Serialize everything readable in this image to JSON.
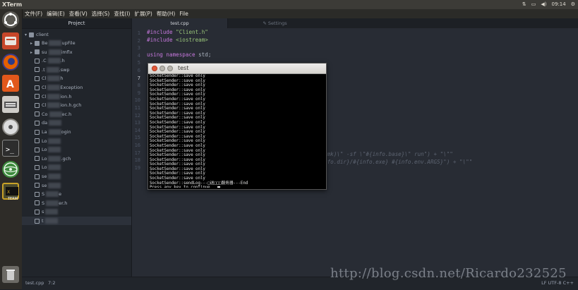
{
  "topbar": {
    "app_title": "XTerm",
    "clock": "09:14"
  },
  "menubar": {
    "items": [
      "文件(F)",
      "编辑(E)",
      "查看(V)",
      "选择(S)",
      "查找(I)",
      "扩展(P)",
      "帮助(H)",
      "File"
    ]
  },
  "sidebar": {
    "header": "Project",
    "root": "client",
    "items": [
      {
        "label": "Be",
        "suffix": "upFile",
        "type": "folder"
      },
      {
        "label": "su",
        "suffix": "imflx",
        "type": "folder"
      },
      {
        "label": ".C",
        "suffix": ".h",
        "type": "file"
      },
      {
        "label": ".t",
        "suffix": ".swp",
        "type": "file"
      },
      {
        "label": "Cl",
        "suffix": "h",
        "type": "file"
      },
      {
        "label": "Cl",
        "suffix": "Exception",
        "type": "file"
      },
      {
        "label": "Cl",
        "suffix": "ion.h",
        "type": "file"
      },
      {
        "label": "Cl",
        "suffix": "ion.h.gch",
        "type": "file"
      },
      {
        "label": "Co",
        "suffix": "ec.h",
        "type": "file"
      },
      {
        "label": "da",
        "suffix": "",
        "type": "file"
      },
      {
        "label": "La",
        "suffix": "ogin",
        "type": "file"
      },
      {
        "label": "Lo",
        "suffix": "",
        "type": "file"
      },
      {
        "label": "Lo",
        "suffix": "",
        "type": "file"
      },
      {
        "label": "Lo",
        "suffix": ".gch",
        "type": "file"
      },
      {
        "label": "Lo",
        "suffix": "",
        "type": "file"
      },
      {
        "label": "se",
        "suffix": "",
        "type": "file"
      },
      {
        "label": "se",
        "suffix": "",
        "type": "file"
      },
      {
        "label": "S",
        "suffix": "e",
        "type": "file"
      },
      {
        "label": "S",
        "suffix": "er.h",
        "type": "file"
      },
      {
        "label": "s",
        "suffix": "",
        "type": "file"
      },
      {
        "label": "t",
        "suffix": "",
        "type": "file"
      }
    ]
  },
  "tabs": {
    "active": "test.cpp",
    "inactive": "Settings"
  },
  "editor": {
    "line_numbers": [
      "1",
      "2",
      "3",
      "4",
      "5",
      "6",
      "7",
      "8",
      "9",
      "10",
      "11",
      "12",
      "13",
      "14",
      "15",
      "16",
      "17",
      "18",
      "19"
    ],
    "current_line": "7",
    "line1": {
      "kw": "#include",
      "str": "\"Client.h\""
    },
    "line2": {
      "kw": "#include",
      "str": "<iostream>"
    },
    "line4": {
      "kw": "using namespace",
      "rest": "std;"
    },
    "line17_tail": "(mk)\\\" -sf \\\"#{info.base}\\\" run\") + \"\\\"\"",
    "line18_tail": "nfo.dir}/#{info.exe} #{info.env.ARGS}\") + \"\\\"\""
  },
  "terminal": {
    "title": "test",
    "repeated_line": "SocketSender::save only",
    "repeat_count": 23,
    "end_line": "SocketSender::sendLog---□送□□□服务器---End",
    "prompt": "Press any key to continue..."
  },
  "status": {
    "filename": "test.cpp",
    "position": "7:2",
    "encoding": "LF  UTF-8  C++"
  },
  "watermark": "http://blog.csdn.net/Ricardo232525",
  "colors": {
    "launcher_bg": "#2e2c28",
    "editor_bg": "#282c34",
    "sidebar_bg": "#21252b"
  }
}
